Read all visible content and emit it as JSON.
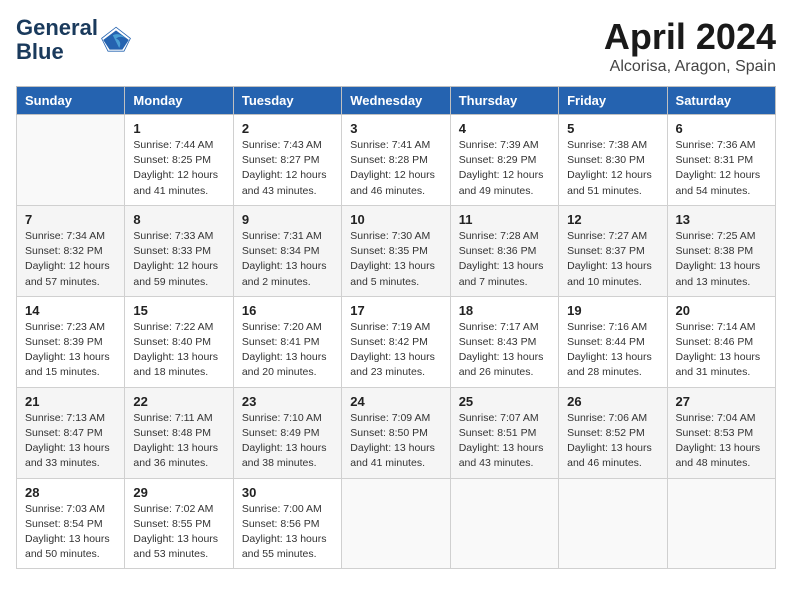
{
  "header": {
    "logo_line1": "General",
    "logo_line2": "Blue",
    "month": "April 2024",
    "location": "Alcorisa, Aragon, Spain"
  },
  "days_of_week": [
    "Sunday",
    "Monday",
    "Tuesday",
    "Wednesday",
    "Thursday",
    "Friday",
    "Saturday"
  ],
  "weeks": [
    [
      {
        "num": "",
        "info": ""
      },
      {
        "num": "1",
        "info": "Sunrise: 7:44 AM\nSunset: 8:25 PM\nDaylight: 12 hours\nand 41 minutes."
      },
      {
        "num": "2",
        "info": "Sunrise: 7:43 AM\nSunset: 8:27 PM\nDaylight: 12 hours\nand 43 minutes."
      },
      {
        "num": "3",
        "info": "Sunrise: 7:41 AM\nSunset: 8:28 PM\nDaylight: 12 hours\nand 46 minutes."
      },
      {
        "num": "4",
        "info": "Sunrise: 7:39 AM\nSunset: 8:29 PM\nDaylight: 12 hours\nand 49 minutes."
      },
      {
        "num": "5",
        "info": "Sunrise: 7:38 AM\nSunset: 8:30 PM\nDaylight: 12 hours\nand 51 minutes."
      },
      {
        "num": "6",
        "info": "Sunrise: 7:36 AM\nSunset: 8:31 PM\nDaylight: 12 hours\nand 54 minutes."
      }
    ],
    [
      {
        "num": "7",
        "info": "Sunrise: 7:34 AM\nSunset: 8:32 PM\nDaylight: 12 hours\nand 57 minutes."
      },
      {
        "num": "8",
        "info": "Sunrise: 7:33 AM\nSunset: 8:33 PM\nDaylight: 12 hours\nand 59 minutes."
      },
      {
        "num": "9",
        "info": "Sunrise: 7:31 AM\nSunset: 8:34 PM\nDaylight: 13 hours\nand 2 minutes."
      },
      {
        "num": "10",
        "info": "Sunrise: 7:30 AM\nSunset: 8:35 PM\nDaylight: 13 hours\nand 5 minutes."
      },
      {
        "num": "11",
        "info": "Sunrise: 7:28 AM\nSunset: 8:36 PM\nDaylight: 13 hours\nand 7 minutes."
      },
      {
        "num": "12",
        "info": "Sunrise: 7:27 AM\nSunset: 8:37 PM\nDaylight: 13 hours\nand 10 minutes."
      },
      {
        "num": "13",
        "info": "Sunrise: 7:25 AM\nSunset: 8:38 PM\nDaylight: 13 hours\nand 13 minutes."
      }
    ],
    [
      {
        "num": "14",
        "info": "Sunrise: 7:23 AM\nSunset: 8:39 PM\nDaylight: 13 hours\nand 15 minutes."
      },
      {
        "num": "15",
        "info": "Sunrise: 7:22 AM\nSunset: 8:40 PM\nDaylight: 13 hours\nand 18 minutes."
      },
      {
        "num": "16",
        "info": "Sunrise: 7:20 AM\nSunset: 8:41 PM\nDaylight: 13 hours\nand 20 minutes."
      },
      {
        "num": "17",
        "info": "Sunrise: 7:19 AM\nSunset: 8:42 PM\nDaylight: 13 hours\nand 23 minutes."
      },
      {
        "num": "18",
        "info": "Sunrise: 7:17 AM\nSunset: 8:43 PM\nDaylight: 13 hours\nand 26 minutes."
      },
      {
        "num": "19",
        "info": "Sunrise: 7:16 AM\nSunset: 8:44 PM\nDaylight: 13 hours\nand 28 minutes."
      },
      {
        "num": "20",
        "info": "Sunrise: 7:14 AM\nSunset: 8:46 PM\nDaylight: 13 hours\nand 31 minutes."
      }
    ],
    [
      {
        "num": "21",
        "info": "Sunrise: 7:13 AM\nSunset: 8:47 PM\nDaylight: 13 hours\nand 33 minutes."
      },
      {
        "num": "22",
        "info": "Sunrise: 7:11 AM\nSunset: 8:48 PM\nDaylight: 13 hours\nand 36 minutes."
      },
      {
        "num": "23",
        "info": "Sunrise: 7:10 AM\nSunset: 8:49 PM\nDaylight: 13 hours\nand 38 minutes."
      },
      {
        "num": "24",
        "info": "Sunrise: 7:09 AM\nSunset: 8:50 PM\nDaylight: 13 hours\nand 41 minutes."
      },
      {
        "num": "25",
        "info": "Sunrise: 7:07 AM\nSunset: 8:51 PM\nDaylight: 13 hours\nand 43 minutes."
      },
      {
        "num": "26",
        "info": "Sunrise: 7:06 AM\nSunset: 8:52 PM\nDaylight: 13 hours\nand 46 minutes."
      },
      {
        "num": "27",
        "info": "Sunrise: 7:04 AM\nSunset: 8:53 PM\nDaylight: 13 hours\nand 48 minutes."
      }
    ],
    [
      {
        "num": "28",
        "info": "Sunrise: 7:03 AM\nSunset: 8:54 PM\nDaylight: 13 hours\nand 50 minutes."
      },
      {
        "num": "29",
        "info": "Sunrise: 7:02 AM\nSunset: 8:55 PM\nDaylight: 13 hours\nand 53 minutes."
      },
      {
        "num": "30",
        "info": "Sunrise: 7:00 AM\nSunset: 8:56 PM\nDaylight: 13 hours\nand 55 minutes."
      },
      {
        "num": "",
        "info": ""
      },
      {
        "num": "",
        "info": ""
      },
      {
        "num": "",
        "info": ""
      },
      {
        "num": "",
        "info": ""
      }
    ]
  ]
}
